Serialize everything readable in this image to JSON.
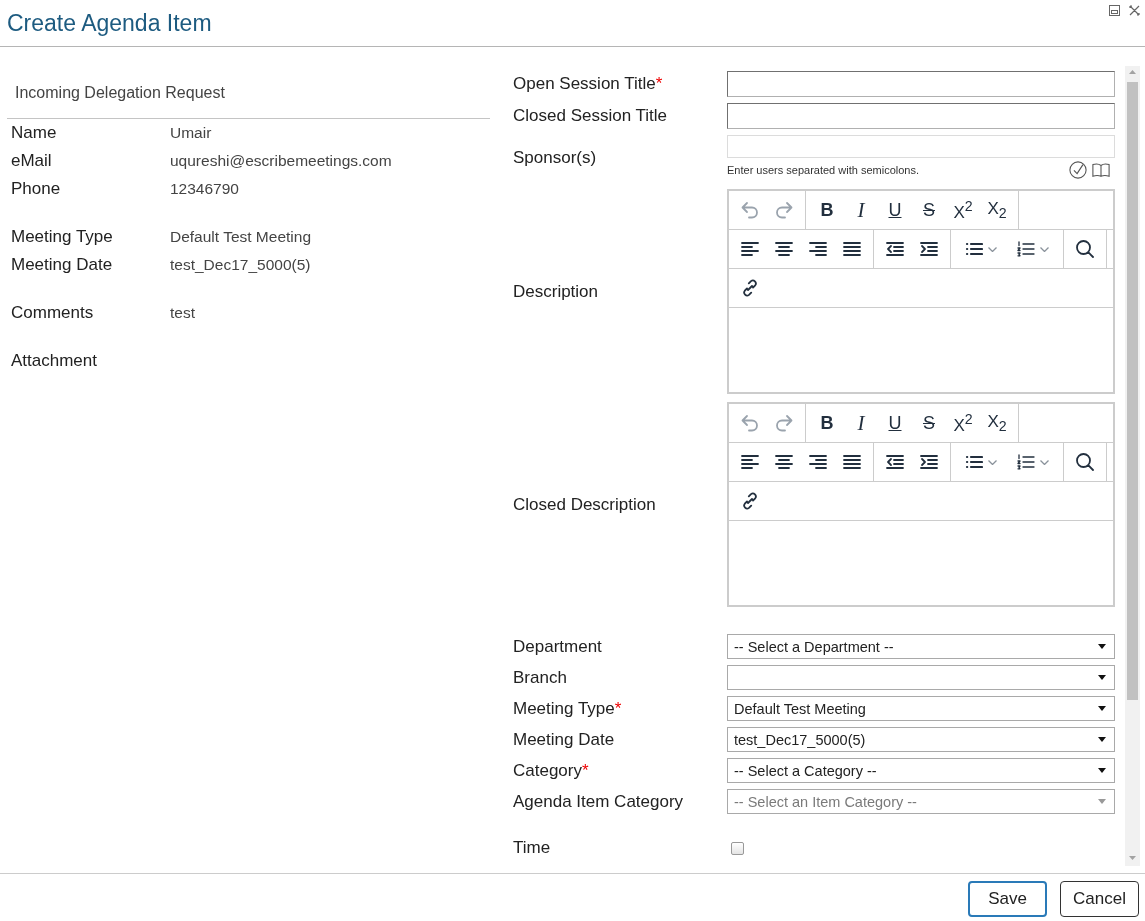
{
  "window": {
    "title": "Create Agenda Item"
  },
  "request": {
    "heading": "Incoming Delegation Request",
    "groups": [
      [
        {
          "label": "Name",
          "value": "Umair"
        },
        {
          "label": "eMail",
          "value": "uqureshi@escribemeetings.com"
        },
        {
          "label": "Phone",
          "value": "12346790"
        }
      ],
      [
        {
          "label": "Meeting Type",
          "value": "Default Test Meeting"
        },
        {
          "label": "Meeting Date",
          "value": "test_Dec17_5000(5)"
        }
      ],
      [
        {
          "label": "Comments",
          "value": "test"
        }
      ],
      [
        {
          "label": "Attachment"
        }
      ]
    ]
  },
  "form": {
    "fields": [
      {
        "kind": "text",
        "label": "Open Session Title",
        "required_mark": "*"
      },
      {
        "kind": "text",
        "label": "Closed Session Title"
      },
      {
        "kind": "people",
        "label": "Sponsor(s)",
        "hint": "Enter users separated with semicolons."
      },
      {
        "kind": "editor",
        "label": "Description",
        "toolbar": [
          [
            [
              {
                "kind": "undo",
                "disabled": true
              },
              {
                "kind": "redo",
                "disabled": true
              }
            ],
            [
              {
                "kind": "bold",
                "glyph": "B",
                "disabled": false
              },
              {
                "kind": "italic",
                "glyph": "I",
                "disabled": false
              },
              {
                "kind": "underline",
                "glyph": "U",
                "disabled": false
              },
              {
                "kind": "strikethrough",
                "glyph": "S",
                "disabled": false
              },
              {
                "kind": "superscript",
                "glyph": "X$^{2}$",
                "disabled": false
              },
              {
                "kind": "subscript",
                "glyph": "X$_{2}$",
                "disabled": false
              }
            ]
          ],
          [
            [
              {
                "kind": "align-left",
                "disabled": false
              },
              {
                "kind": "align-center",
                "disabled": false
              },
              {
                "kind": "align-right",
                "disabled": false
              },
              {
                "kind": "justify",
                "disabled": false
              }
            ],
            [
              {
                "kind": "outdent",
                "disabled": false
              },
              {
                "kind": "indent",
                "disabled": false
              }
            ],
            [
              {
                "kind": "bullet-list",
                "disabled": false
              },
              {
                "kind": "numbered-list",
                "disabled": false
              }
            ],
            [
              {
                "kind": "search",
                "disabled": false
              }
            ]
          ],
          [
            [
              {
                "kind": "link",
                "disabled": false
              }
            ]
          ]
        ]
      },
      {
        "kind": "editor",
        "label": "Closed Description",
        "toolbar": [
          [
            [
              {
                "kind": "undo",
                "disabled": true
              },
              {
                "kind": "redo",
                "disabled": true
              }
            ],
            [
              {
                "kind": "bold",
                "glyph": "B",
                "disabled": false
              },
              {
                "kind": "italic",
                "glyph": "I",
                "disabled": false
              },
              {
                "kind": "underline",
                "glyph": "U",
                "disabled": false
              },
              {
                "kind": "strikethrough",
                "glyph": "S",
                "disabled": false
              },
              {
                "kind": "superscript",
                "glyph": "X$^{2}$",
                "disabled": false
              },
              {
                "kind": "subscript",
                "glyph": "X$_{2}$",
                "disabled": false
              }
            ]
          ],
          [
            [
              {
                "kind": "align-left",
                "disabled": false
              },
              {
                "kind": "align-center",
                "disabled": false
              },
              {
                "kind": "align-right",
                "disabled": false
              },
              {
                "kind": "justify",
                "disabled": false
              }
            ],
            [
              {
                "kind": "outdent",
                "disabled": false
              },
              {
                "kind": "indent",
                "disabled": false
              }
            ],
            [
              {
                "kind": "bullet-list",
                "disabled": false
              },
              {
                "kind": "numbered-list",
                "disabled": false
              }
            ],
            [
              {
                "kind": "search",
                "disabled": false
              }
            ]
          ],
          [
            [
              {
                "kind": "link",
                "disabled": false
              }
            ]
          ]
        ]
      },
      {
        "kind": "select",
        "label": "Department",
        "value": "-- Select a Department --",
        "disabled": false
      },
      {
        "kind": "select",
        "label": "Branch",
        "disabled": false
      },
      {
        "kind": "select",
        "label": "Meeting Type",
        "required_mark": "*",
        "value": "Default Test Meeting",
        "disabled": false
      },
      {
        "kind": "select",
        "label": "Meeting Date",
        "value": "test_Dec17_5000(5)",
        "disabled": false
      },
      {
        "kind": "select",
        "label": "Category",
        "required_mark": "*",
        "value": "-- Select a Category --",
        "disabled": false
      },
      {
        "kind": "select",
        "label": "Agenda Item Category",
        "value": "-- Select an Item Category --",
        "disabled": true
      },
      {
        "kind": "checkbox",
        "label": "Time",
        "checked": false
      }
    ]
  },
  "buttons": [
    {
      "label": "Save",
      "focused": true
    },
    {
      "label": "Cancel",
      "focused": false
    }
  ]
}
